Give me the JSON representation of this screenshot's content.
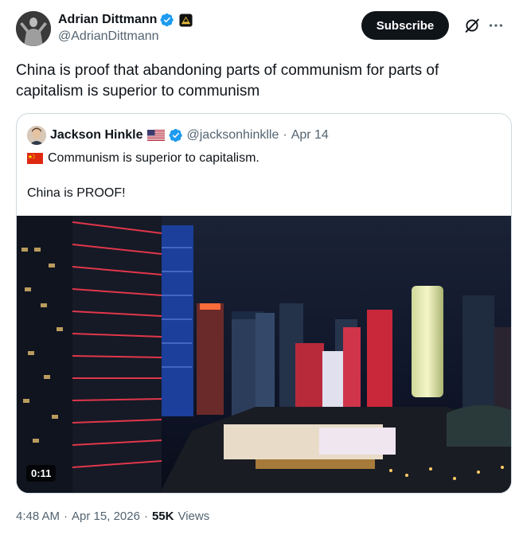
{
  "author": {
    "display_name": "Adrian Dittmann",
    "handle": "@AdrianDittmann",
    "verified_icon": "verified-badge-icon",
    "affiliate_icon": "affiliate-badge-icon"
  },
  "actions": {
    "subscribe_label": "Subscribe",
    "grok_icon": "grok-icon",
    "more_icon": "more-icon"
  },
  "tweet": {
    "text": "China is proof that abandoning parts of communism for parts of capitalism is superior to communism"
  },
  "quote": {
    "display_name": "Jackson Hinkle",
    "flag_icon": "us-flag-icon",
    "verified_icon": "verified-badge-icon",
    "handle": "@jacksonhinklle",
    "separator": "·",
    "date": "Apr 14",
    "line1_flag_icon": "china-flag-icon",
    "line1": "Communism is superior to capitalism.",
    "line2": "China is PROOF!",
    "video_duration": "0:11"
  },
  "meta": {
    "time": "4:48 AM",
    "sep1": "·",
    "date": "Apr 15, 2026",
    "sep2": "·",
    "views_count": "55K",
    "views_label": "Views"
  },
  "colors": {
    "text_primary": "#0f1419",
    "text_secondary": "#536471",
    "verified_blue": "#1d9bf0",
    "border": "#cfd9de",
    "button_bg": "#0f1419"
  }
}
